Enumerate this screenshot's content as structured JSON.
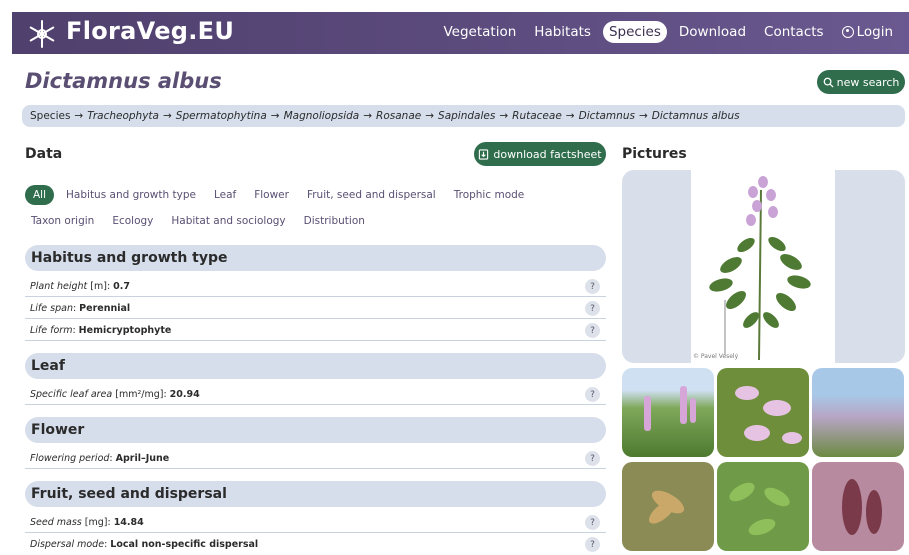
{
  "brand": {
    "name": "FloraVeg.EU",
    "icon": "asterisk-snowflake-icon"
  },
  "nav": {
    "items": [
      {
        "label": "Vegetation"
      },
      {
        "label": "Habitats"
      },
      {
        "label": "Species"
      },
      {
        "label": "Download"
      },
      {
        "label": "Contacts"
      },
      {
        "label": "Login"
      }
    ],
    "active": "Species"
  },
  "page": {
    "title": "Dictamnus albus",
    "new_search_label": "new search"
  },
  "breadcrumb": {
    "items": [
      "Species",
      "Tracheophyta",
      "Spermatophytina",
      "Magnoliopsida",
      "Rosanae",
      "Sapindales",
      "Rutaceae",
      "Dictamnus",
      "Dictamnus albus"
    ],
    "separator": "→"
  },
  "data_panel": {
    "heading": "Data",
    "download_label": "download factsheet",
    "filters_row1": [
      "All",
      "Habitus and growth type",
      "Leaf",
      "Flower",
      "Fruit, seed and dispersal",
      "Trophic mode"
    ],
    "filters_row2": [
      "Taxon origin",
      "Ecology",
      "Habitat and sociology",
      "Distribution"
    ]
  },
  "sections": {
    "habitus": {
      "title": "Habitus and growth type",
      "rows": [
        {
          "name": "Plant height",
          "unit": "[m]",
          "value": "0.7"
        },
        {
          "name": "Life span",
          "unit": "",
          "value": "Perennial"
        },
        {
          "name": "Life form",
          "unit": "",
          "value": "Hemicryptophyte"
        }
      ]
    },
    "leaf": {
      "title": "Leaf",
      "rows": [
        {
          "name": "Specific leaf area",
          "unit": "[mm²/mg]",
          "value": "20.94"
        }
      ]
    },
    "flower": {
      "title": "Flower",
      "rows": [
        {
          "name": "Flowering period",
          "unit": "",
          "value": "April–June"
        }
      ]
    },
    "fruit": {
      "title": "Fruit, seed and dispersal",
      "rows": [
        {
          "name": "Seed mass",
          "unit": "[mg]",
          "value": "14.84"
        },
        {
          "name": "Dispersal mode",
          "unit": "",
          "value": "Local non-specific dispersal"
        }
      ]
    }
  },
  "pictures": {
    "heading": "Pictures",
    "main_credit": "© Pavel Veselý",
    "help_label": "?"
  },
  "colors": {
    "brand_purple": "#5b4a7c",
    "accent_green": "#2f6d4c",
    "section_bg": "#d6deec"
  }
}
